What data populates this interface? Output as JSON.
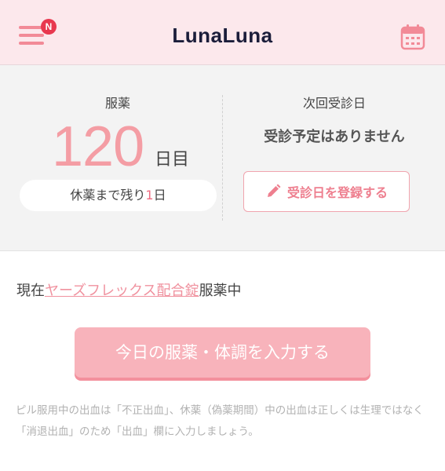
{
  "header": {
    "menu_badge": "N",
    "logo": "LunaLuna"
  },
  "status": {
    "medication_label": "服薬",
    "medication_day": "120",
    "medication_day_unit": "日目",
    "rest_prefix": "休薬まで残り",
    "rest_days": "1",
    "rest_suffix": "日",
    "next_visit_label": "次回受診日",
    "no_appointment": "受診予定はありません",
    "register_button": "受診日を登録する"
  },
  "current": {
    "prefix": "現在",
    "drug_name": "ヤーズフレックス配合錠",
    "suffix": "服薬中"
  },
  "input_button": "今日の服薬・体調を入力する",
  "note": "ピル服用中の出血は「不正出血」、休薬（偽薬期間）中の出血は正しくは生理ではなく「消退出血」のため「出血」欄に入力しましょう。",
  "colors": {
    "header_bg": "#fce8ec",
    "accent": "#f28a97",
    "badge": "#e8384f",
    "logo": "#1b1d3a",
    "day_number": "#f49da4",
    "button_bg": "#f8b3bb"
  },
  "icons": [
    "hamburger-menu-icon",
    "calendar-icon",
    "pencil-icon"
  ]
}
